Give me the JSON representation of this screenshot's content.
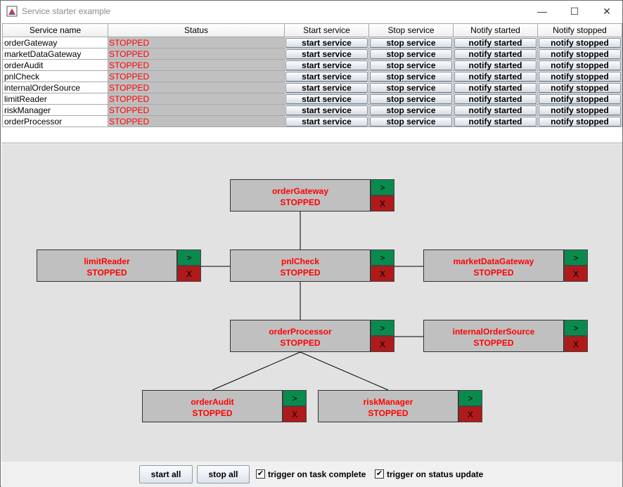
{
  "window": {
    "title": "Service starter example",
    "controls": {
      "minimize": "—",
      "maximize": "☐",
      "close": "✕"
    }
  },
  "table": {
    "headers": [
      "Service name",
      "Status",
      "Start service",
      "Stop service",
      "Notify started",
      "Notify stopped"
    ],
    "rows": [
      {
        "name": "orderGateway",
        "status": "STOPPED"
      },
      {
        "name": "marketDataGateway",
        "status": "STOPPED"
      },
      {
        "name": "orderAudit",
        "status": "STOPPED"
      },
      {
        "name": "pnlCheck",
        "status": "STOPPED"
      },
      {
        "name": "internalOrderSource",
        "status": "STOPPED"
      },
      {
        "name": "limitReader",
        "status": "STOPPED"
      },
      {
        "name": "riskManager",
        "status": "STOPPED"
      },
      {
        "name": "orderProcessor",
        "status": "STOPPED"
      }
    ],
    "button_labels": {
      "start": "start service",
      "stop": "stop service",
      "notify_started": "notify started",
      "notify_stopped": "notify stopped"
    }
  },
  "graph": {
    "start_label": ">",
    "stop_label": "X",
    "nodes": {
      "orderGateway": {
        "name": "orderGateway",
        "status": "STOPPED"
      },
      "limitReader": {
        "name": "limitReader",
        "status": "STOPPED"
      },
      "pnlCheck": {
        "name": "pnlCheck",
        "status": "STOPPED"
      },
      "marketDataGateway": {
        "name": "marketDataGateway",
        "status": "STOPPED"
      },
      "orderProcessor": {
        "name": "orderProcessor",
        "status": "STOPPED"
      },
      "internalOrderSource": {
        "name": "internalOrderSource",
        "status": "STOPPED"
      },
      "orderAudit": {
        "name": "orderAudit",
        "status": "STOPPED"
      },
      "riskManager": {
        "name": "riskManager",
        "status": "STOPPED"
      }
    }
  },
  "bottom": {
    "start_all": "start all",
    "stop_all": "stop all",
    "trigger_task_complete": {
      "label": "trigger on task complete",
      "checked": true
    },
    "trigger_status_update": {
      "label": "trigger on status update",
      "checked": true
    },
    "check_mark": "✔"
  },
  "colors": {
    "status_text": "#ff0000",
    "start_button": "#0b8a4e",
    "stop_button": "#b01a1a",
    "node_fill": "#c0c0c0",
    "graph_background": "#e2e2e2"
  }
}
